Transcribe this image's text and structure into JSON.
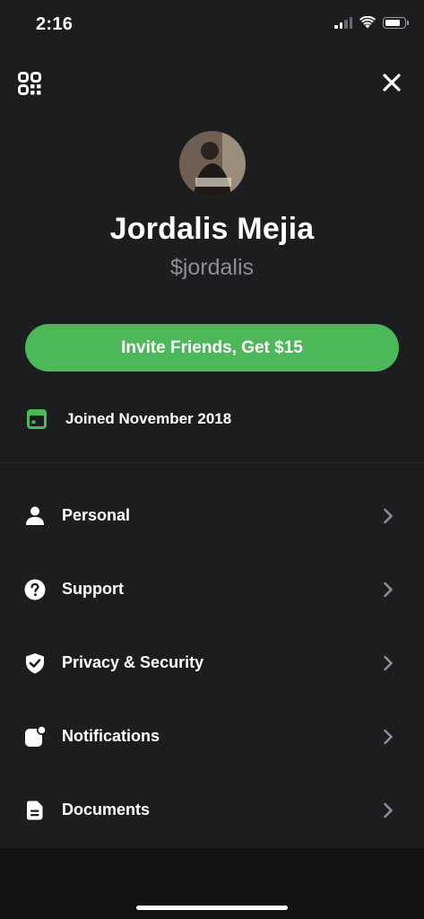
{
  "status_bar": {
    "time": "2:16",
    "signal_icon": "cellular-signal-icon",
    "wifi_icon": "wifi-icon",
    "battery_icon": "battery-icon"
  },
  "header": {
    "qr_icon": "qr-code-icon",
    "close_icon": "close-icon"
  },
  "profile": {
    "name": "Jordalis Mejia",
    "cashtag": "$jordalis",
    "avatar": "profile-photo"
  },
  "invite": {
    "label": "Invite Friends, Get $15",
    "color": "#4cb85a"
  },
  "joined": {
    "icon": "calendar-icon",
    "text": "Joined November 2018"
  },
  "menu": {
    "items": [
      {
        "label": "Personal",
        "icon": "person-icon"
      },
      {
        "label": "Support",
        "icon": "question-icon"
      },
      {
        "label": "Privacy & Security",
        "icon": "shield-check-icon"
      },
      {
        "label": "Notifications",
        "icon": "notification-icon"
      },
      {
        "label": "Documents",
        "icon": "document-icon"
      }
    ],
    "chevron_icon": "chevron-right-icon"
  },
  "colors": {
    "background": "#1c1d1f",
    "accent": "#4cb85a",
    "secondary_text": "#8e8e93"
  }
}
